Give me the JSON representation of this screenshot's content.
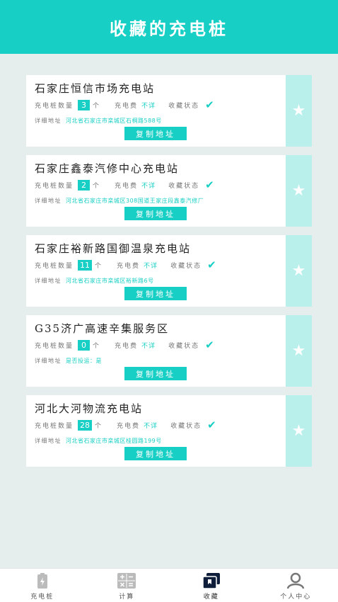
{
  "header": {
    "title": "收藏的充电桩"
  },
  "labels": {
    "count_label": "充电桩数量",
    "count_unit": "个",
    "fee_label": "充电费",
    "status_label": "收藏状态",
    "address_label": "详细地址",
    "copy_button": "复制地址"
  },
  "stations": [
    {
      "name": "石家庄恒信市场充电站",
      "count": "3",
      "fee": "不详",
      "address": "河北省石家庄市栾城区石桐路588号"
    },
    {
      "name": "石家庄鑫泰汽修中心充电站",
      "count": "2",
      "fee": "不详",
      "address": "河北省石家庄市栾城区308国道王家庄段鑫泰汽修厂"
    },
    {
      "name": "石家庄裕新路国御温泉充电站",
      "count": "11",
      "fee": "不详",
      "address": "河北省石家庄市栾城区裕新路6号"
    },
    {
      "name": "G35济广高速辛集服务区",
      "count": "0",
      "fee": "不详",
      "address": "是否投运：是"
    },
    {
      "name": "河北大河物流充电站",
      "count": "28",
      "fee": "不详",
      "address": "河北省石家庄市栾城区桂圆路199号"
    }
  ],
  "tabbar": [
    {
      "label": "充电桩",
      "icon": "battery-icon"
    },
    {
      "label": "计算",
      "icon": "calculator-icon"
    },
    {
      "label": "收藏",
      "icon": "favorites-icon"
    },
    {
      "label": "个人中心",
      "icon": "profile-icon"
    }
  ],
  "colors": {
    "accent": "#17cfc4",
    "side": "#b9f0ec",
    "background": "#e6eded"
  }
}
